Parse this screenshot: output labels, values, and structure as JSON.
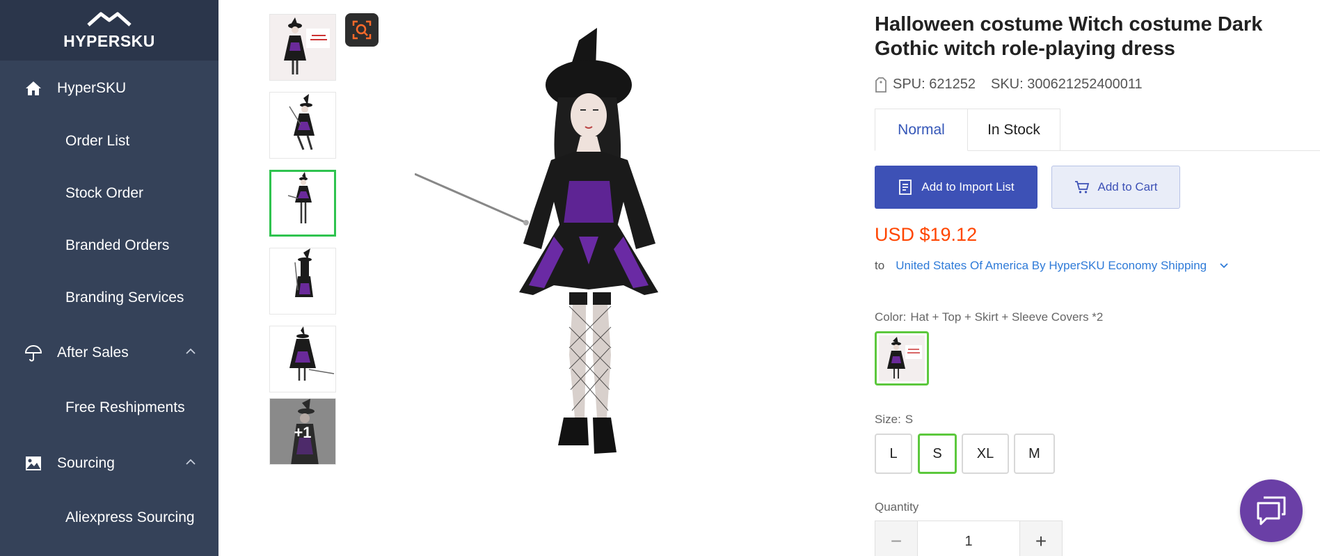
{
  "app": {
    "logo_text": "HYPERSKU"
  },
  "sidebar": {
    "items": [
      {
        "label": "HyperSKU",
        "icon": "home-icon"
      },
      {
        "label": "Order List"
      },
      {
        "label": "Stock Order"
      },
      {
        "label": "Branded Orders"
      },
      {
        "label": "Branding Services"
      },
      {
        "label": "After Sales",
        "icon": "umbrella-icon",
        "expanded": true
      },
      {
        "label": "Free Reshipments"
      },
      {
        "label": "Sourcing",
        "icon": "image-icon",
        "expanded": true
      },
      {
        "label": "Aliexpress Sourcing"
      }
    ]
  },
  "gallery": {
    "more_label": "+1",
    "active_index": 2,
    "zoom_icon": "zoom-search-icon",
    "zoom_color": "#ff6a2a"
  },
  "product": {
    "title": "Halloween costume Witch costume Dark Gothic witch role-playing dress",
    "spu": "SPU: 621252",
    "sku": "SKU: 300621252400011",
    "tabs": [
      {
        "label": "Normal",
        "active": true
      },
      {
        "label": "In Stock",
        "active": false
      }
    ],
    "add_to_import_label": "Add to Import List",
    "add_to_cart_label": "Add to Cart",
    "price": "USD $19.12",
    "ship_to_label": "to",
    "shipping_method": "United States Of America By HyperSKU Economy Shipping",
    "color_label": "Color:",
    "color_value": "Hat + Top + Skirt + Sleeve Covers *2",
    "size_label": "Size:",
    "size_value": "S",
    "sizes": [
      "L",
      "S",
      "XL",
      "M"
    ],
    "selected_size": "S",
    "quantity_label": "Quantity",
    "quantity": "1",
    "dec_symbol": "−",
    "inc_symbol": "+"
  },
  "colors": {
    "sidebar_bg": "#354259",
    "accent_blue": "#3d51b6",
    "price_orange": "#ff4500",
    "select_green": "#5cc83d",
    "chat_purple": "#6a3fa6"
  },
  "chat": {
    "icon": "chat-bubbles-icon"
  }
}
